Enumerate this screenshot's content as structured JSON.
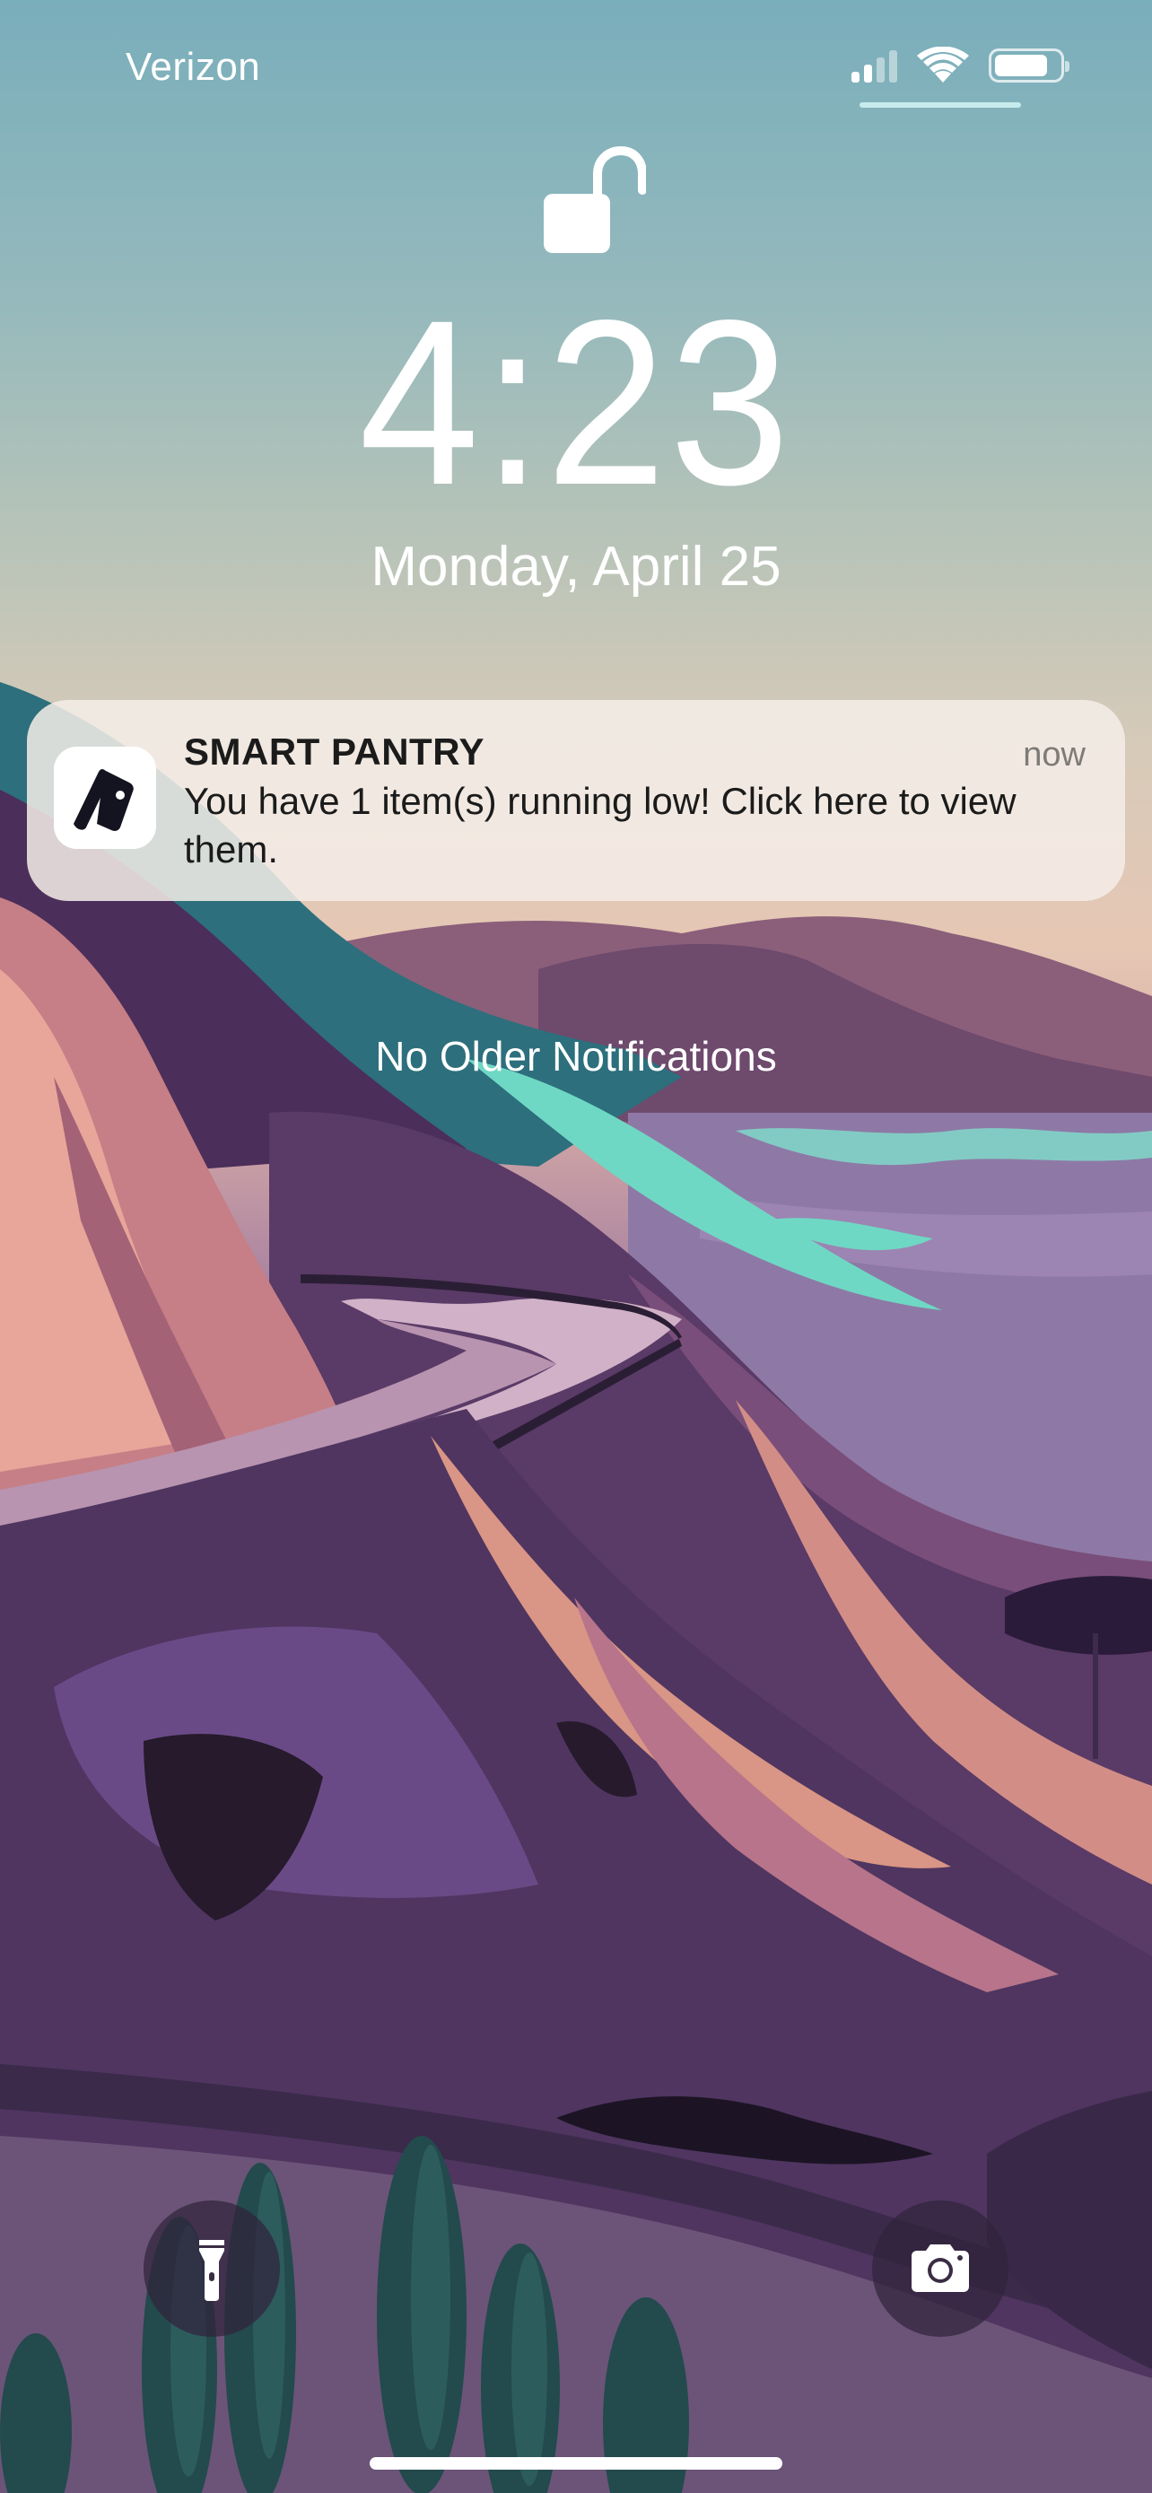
{
  "status_bar": {
    "carrier": "Verizon",
    "signal_bars": 4,
    "signal_bars_active": 2,
    "wifi_icon": "wifi-icon",
    "battery_icon": "battery-icon"
  },
  "lock_screen": {
    "lock_icon": "unlocked-padlock-icon",
    "time": "4:23",
    "date": "Monday, April 25"
  },
  "notification": {
    "app_name": "SMART PANTRY",
    "timestamp": "now",
    "message": "You have 1 item(s) running low! Click here to view them.",
    "app_icon": "smart-pantry-app-icon"
  },
  "notification_center": {
    "empty_message": "No Older Notifications"
  },
  "quick_actions": {
    "flashlight_icon": "flashlight-icon",
    "camera_icon": "camera-icon"
  },
  "colors": {
    "sky_top": "#79aebb",
    "sky_bottom": "#e6c7b4",
    "notification_bg": "#f4eee8",
    "text_primary": "#1b1b1b",
    "text_secondary": "#7e7a76",
    "button_bg": "#30243c"
  }
}
